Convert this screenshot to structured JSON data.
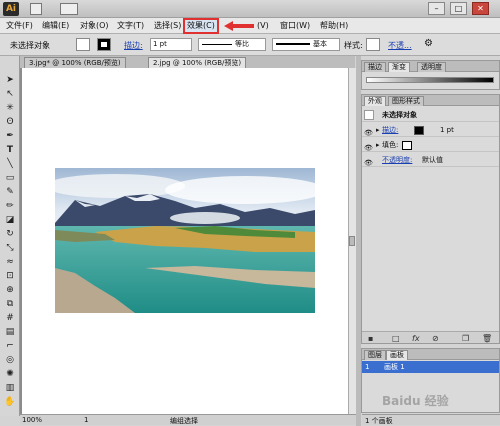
{
  "app": {
    "logo": "Ai",
    "window_controls": [
      "–",
      "□",
      "✕"
    ]
  },
  "menubar": {
    "items": [
      {
        "label": "文件(F)"
      },
      {
        "label": "编辑(E)"
      },
      {
        "label": "对象(O)"
      },
      {
        "label": "文字(T)"
      },
      {
        "label": "选择(S)"
      },
      {
        "label": "效果(C)",
        "highlighted": true
      },
      {
        "label": "(V)"
      },
      {
        "label": "窗口(W)"
      },
      {
        "label": "帮助(H)"
      }
    ]
  },
  "controlbar": {
    "selection": "未选择对象",
    "stroke_label": "描边:",
    "stroke_value": "1 pt",
    "stroke_profile": "等比",
    "brush": "基本",
    "style_label": "样式:",
    "opacity_link": "不透..."
  },
  "tabs": [
    {
      "label": "3.jpg* @ 100% (RGB/预览)"
    },
    {
      "label": "2.jpg @ 100% (RGB/预览)"
    }
  ],
  "status": {
    "zoom": "100%",
    "artboard": "1",
    "tool": "编组选择"
  },
  "panels": {
    "top_tabs": [
      "描边",
      "渐变",
      "透明度"
    ],
    "appearance_tabs": [
      "外观",
      "图形样式"
    ],
    "appearance_title": "未选择对象",
    "stroke_label": "描边:",
    "stroke_value": "1 pt",
    "fill_label": "填色:",
    "opacity_label": "不透明度:",
    "opacity_value": "默认值",
    "layers_tabs": [
      "图层",
      "画板"
    ],
    "layer_row": {
      "index": "1",
      "name": "画板 1"
    },
    "layers_count": "1 个画板"
  },
  "watermark": "Baidu 经验",
  "colors": {
    "highlight": "#e03030",
    "selected_row": "#3a6fd0",
    "link": "#1a3fb0"
  }
}
